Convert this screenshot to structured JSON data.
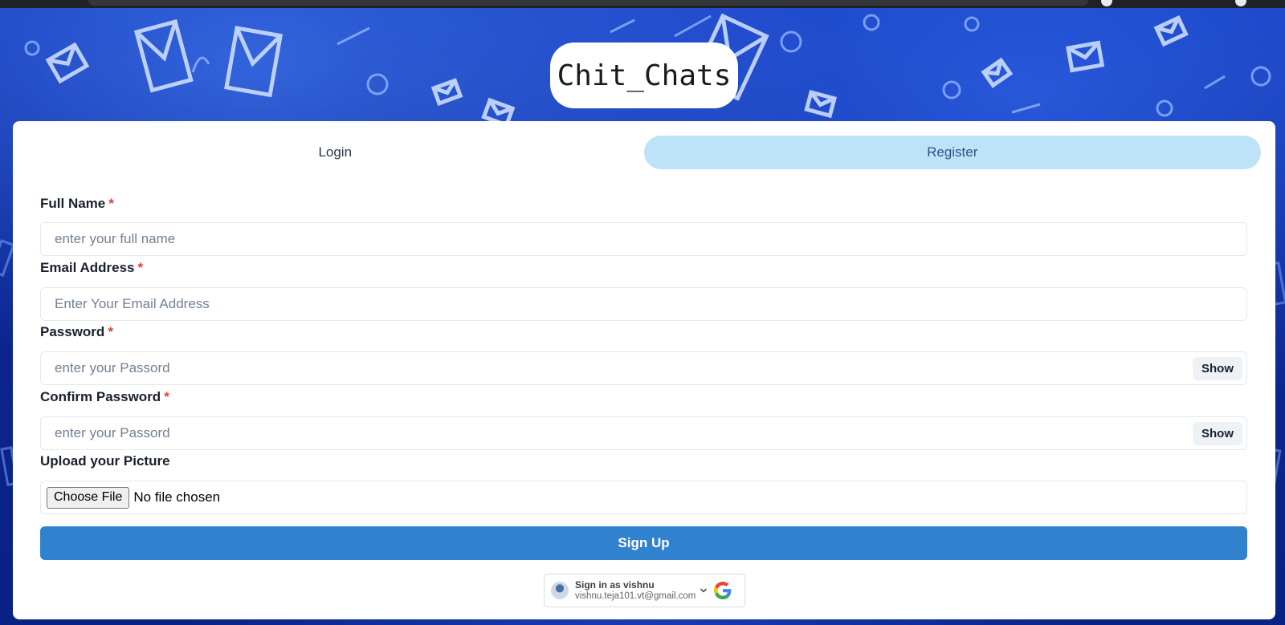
{
  "app": {
    "title": "Chit_Chats"
  },
  "tabs": [
    {
      "label": "Login",
      "active": false
    },
    {
      "label": "Register",
      "active": true
    }
  ],
  "form": {
    "full_name": {
      "label": "Full Name",
      "required_mark": "*",
      "placeholder": "enter your full name",
      "value": ""
    },
    "email": {
      "label": "Email Address",
      "required_mark": "*",
      "placeholder": "Enter Your Email Address",
      "value": ""
    },
    "password": {
      "label": "Password",
      "required_mark": "*",
      "placeholder": "enter your Passord",
      "value": "",
      "toggle_label": "Show"
    },
    "confirm_password": {
      "label": "Confirm Password",
      "required_mark": "*",
      "placeholder": "enter your Passord",
      "value": "",
      "toggle_label": "Show"
    },
    "picture": {
      "label": "Upload your Picture",
      "button_label": "Choose File",
      "status": "No file chosen"
    },
    "submit_label": "Sign Up"
  },
  "google_one_tap": {
    "title": "Sign in as vishnu",
    "email": "vishnu.teja101.vt@gmail.com",
    "icons": [
      "avatar",
      "chevron-down-icon",
      "google-logo-icon"
    ]
  },
  "colors": {
    "background": "#0b2591",
    "tab_active_bg": "#bee3f8",
    "tab_active_text": "#2c5282",
    "primary_button": "#3182ce",
    "required_mark": "#e53e3e"
  }
}
